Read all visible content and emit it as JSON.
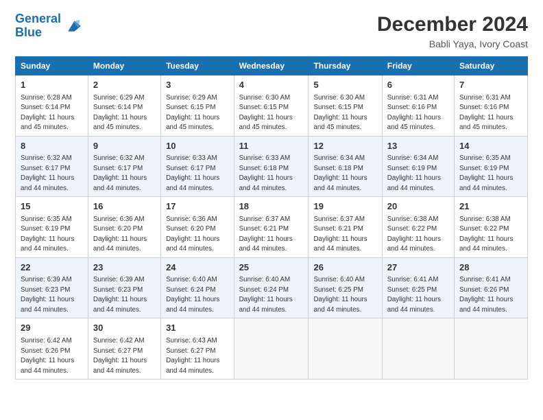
{
  "logo": {
    "text1": "General",
    "text2": "Blue"
  },
  "title": "December 2024",
  "subtitle": "Babli Yaya, Ivory Coast",
  "days_of_week": [
    "Sunday",
    "Monday",
    "Tuesday",
    "Wednesday",
    "Thursday",
    "Friday",
    "Saturday"
  ],
  "weeks": [
    [
      {
        "day": "1",
        "sunrise": "6:28 AM",
        "sunset": "6:14 PM",
        "daylight": "11 hours and 45 minutes."
      },
      {
        "day": "2",
        "sunrise": "6:29 AM",
        "sunset": "6:14 PM",
        "daylight": "11 hours and 45 minutes."
      },
      {
        "day": "3",
        "sunrise": "6:29 AM",
        "sunset": "6:15 PM",
        "daylight": "11 hours and 45 minutes."
      },
      {
        "day": "4",
        "sunrise": "6:30 AM",
        "sunset": "6:15 PM",
        "daylight": "11 hours and 45 minutes."
      },
      {
        "day": "5",
        "sunrise": "6:30 AM",
        "sunset": "6:15 PM",
        "daylight": "11 hours and 45 minutes."
      },
      {
        "day": "6",
        "sunrise": "6:31 AM",
        "sunset": "6:16 PM",
        "daylight": "11 hours and 45 minutes."
      },
      {
        "day": "7",
        "sunrise": "6:31 AM",
        "sunset": "6:16 PM",
        "daylight": "11 hours and 45 minutes."
      }
    ],
    [
      {
        "day": "8",
        "sunrise": "6:32 AM",
        "sunset": "6:17 PM",
        "daylight": "11 hours and 44 minutes."
      },
      {
        "day": "9",
        "sunrise": "6:32 AM",
        "sunset": "6:17 PM",
        "daylight": "11 hours and 44 minutes."
      },
      {
        "day": "10",
        "sunrise": "6:33 AM",
        "sunset": "6:17 PM",
        "daylight": "11 hours and 44 minutes."
      },
      {
        "day": "11",
        "sunrise": "6:33 AM",
        "sunset": "6:18 PM",
        "daylight": "11 hours and 44 minutes."
      },
      {
        "day": "12",
        "sunrise": "6:34 AM",
        "sunset": "6:18 PM",
        "daylight": "11 hours and 44 minutes."
      },
      {
        "day": "13",
        "sunrise": "6:34 AM",
        "sunset": "6:19 PM",
        "daylight": "11 hours and 44 minutes."
      },
      {
        "day": "14",
        "sunrise": "6:35 AM",
        "sunset": "6:19 PM",
        "daylight": "11 hours and 44 minutes."
      }
    ],
    [
      {
        "day": "15",
        "sunrise": "6:35 AM",
        "sunset": "6:19 PM",
        "daylight": "11 hours and 44 minutes."
      },
      {
        "day": "16",
        "sunrise": "6:36 AM",
        "sunset": "6:20 PM",
        "daylight": "11 hours and 44 minutes."
      },
      {
        "day": "17",
        "sunrise": "6:36 AM",
        "sunset": "6:20 PM",
        "daylight": "11 hours and 44 minutes."
      },
      {
        "day": "18",
        "sunrise": "6:37 AM",
        "sunset": "6:21 PM",
        "daylight": "11 hours and 44 minutes."
      },
      {
        "day": "19",
        "sunrise": "6:37 AM",
        "sunset": "6:21 PM",
        "daylight": "11 hours and 44 minutes."
      },
      {
        "day": "20",
        "sunrise": "6:38 AM",
        "sunset": "6:22 PM",
        "daylight": "11 hours and 44 minutes."
      },
      {
        "day": "21",
        "sunrise": "6:38 AM",
        "sunset": "6:22 PM",
        "daylight": "11 hours and 44 minutes."
      }
    ],
    [
      {
        "day": "22",
        "sunrise": "6:39 AM",
        "sunset": "6:23 PM",
        "daylight": "11 hours and 44 minutes."
      },
      {
        "day": "23",
        "sunrise": "6:39 AM",
        "sunset": "6:23 PM",
        "daylight": "11 hours and 44 minutes."
      },
      {
        "day": "24",
        "sunrise": "6:40 AM",
        "sunset": "6:24 PM",
        "daylight": "11 hours and 44 minutes."
      },
      {
        "day": "25",
        "sunrise": "6:40 AM",
        "sunset": "6:24 PM",
        "daylight": "11 hours and 44 minutes."
      },
      {
        "day": "26",
        "sunrise": "6:40 AM",
        "sunset": "6:25 PM",
        "daylight": "11 hours and 44 minutes."
      },
      {
        "day": "27",
        "sunrise": "6:41 AM",
        "sunset": "6:25 PM",
        "daylight": "11 hours and 44 minutes."
      },
      {
        "day": "28",
        "sunrise": "6:41 AM",
        "sunset": "6:26 PM",
        "daylight": "11 hours and 44 minutes."
      }
    ],
    [
      {
        "day": "29",
        "sunrise": "6:42 AM",
        "sunset": "6:26 PM",
        "daylight": "11 hours and 44 minutes."
      },
      {
        "day": "30",
        "sunrise": "6:42 AM",
        "sunset": "6:27 PM",
        "daylight": "11 hours and 44 minutes."
      },
      {
        "day": "31",
        "sunrise": "6:43 AM",
        "sunset": "6:27 PM",
        "daylight": "11 hours and 44 minutes."
      },
      null,
      null,
      null,
      null
    ]
  ]
}
